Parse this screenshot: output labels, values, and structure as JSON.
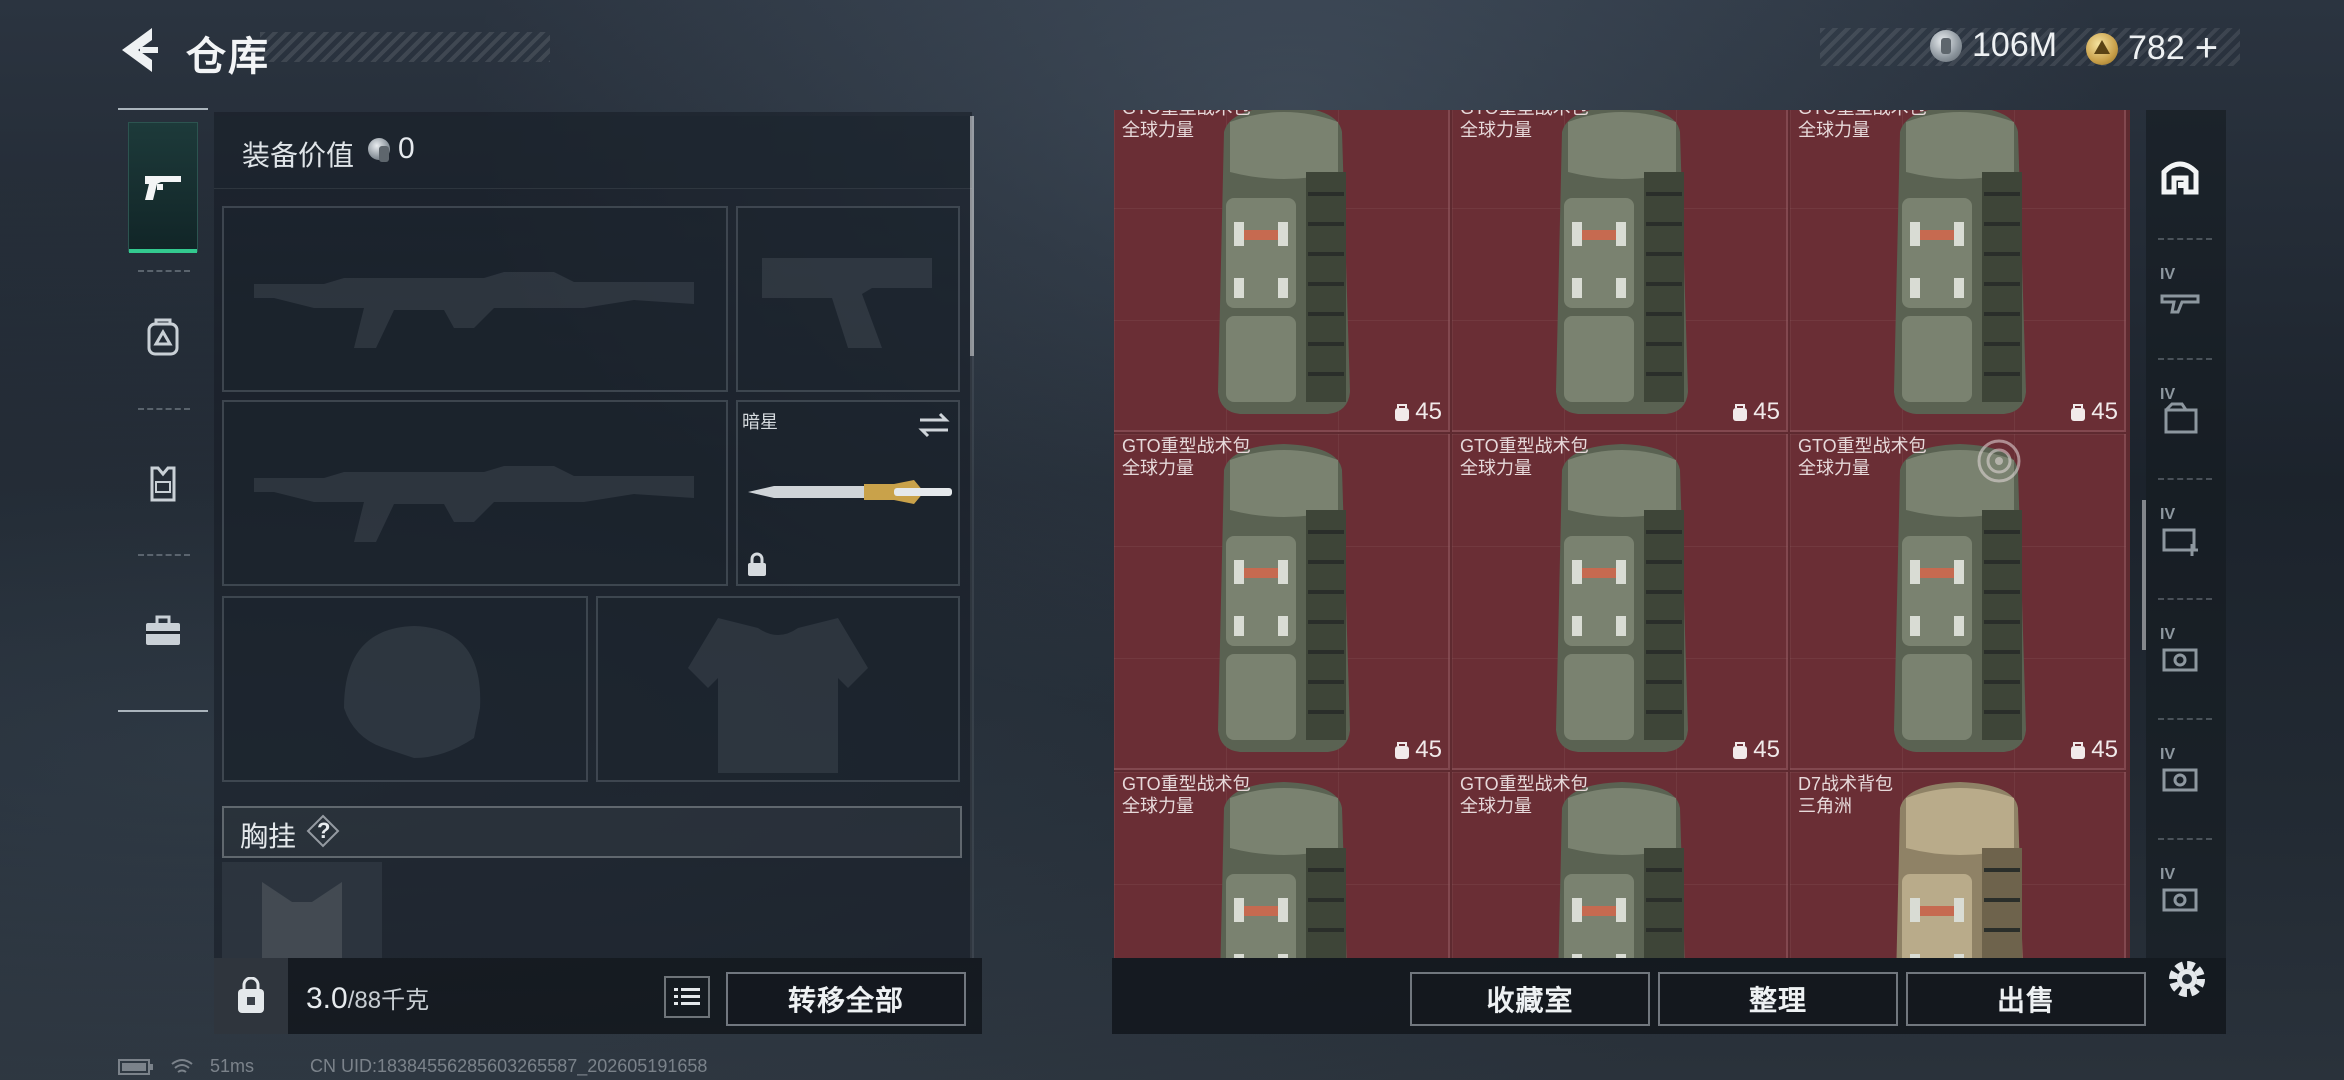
{
  "header": {
    "title": "仓库",
    "currencies": [
      {
        "icon": "silver-coin-icon",
        "amount": "106M"
      },
      {
        "icon": "gold-coin-icon",
        "amount": "782"
      }
    ],
    "add_symbol": "+"
  },
  "left_tabs": [
    {
      "icon": "pistol-icon",
      "active": true
    },
    {
      "icon": "backpack-icon",
      "active": false
    },
    {
      "icon": "chest-rig-icon",
      "active": false
    },
    {
      "icon": "toolbox-icon",
      "active": false
    }
  ],
  "loadout": {
    "value_label": "装备价值",
    "value": "0",
    "melee_name": "暗星",
    "chest_rig_label": "胸挂",
    "chest_rig_help": "?"
  },
  "footer_left": {
    "weight_current": "3.0",
    "weight_max": "/88千克",
    "transfer_all": "转移全部"
  },
  "stash": {
    "items": [
      {
        "name": "GTO重型战术包",
        "source": "全球力量",
        "capacity": "45",
        "variant": "olive",
        "marked": false
      },
      {
        "name": "GTO重型战术包",
        "source": "全球力量",
        "capacity": "45",
        "variant": "olive",
        "marked": false
      },
      {
        "name": "GTO重型战术包",
        "source": "全球力量",
        "capacity": "45",
        "variant": "olive",
        "marked": false
      },
      {
        "name": "GTO重型战术包",
        "source": "全球力量",
        "capacity": "45",
        "variant": "olive",
        "marked": false
      },
      {
        "name": "GTO重型战术包",
        "source": "全球力量",
        "capacity": "45",
        "variant": "olive",
        "marked": false
      },
      {
        "name": "GTO重型战术包",
        "source": "全球力量",
        "capacity": "45",
        "variant": "olive",
        "marked": true
      },
      {
        "name": "GTO重型战术包",
        "source": "全球力量",
        "capacity": "",
        "variant": "olive",
        "marked": false
      },
      {
        "name": "GTO重型战术包",
        "source": "全球力量",
        "capacity": "",
        "variant": "olive",
        "marked": false
      },
      {
        "name": "D7战术背包",
        "source": "三角洲",
        "capacity": "",
        "variant": "tan",
        "marked": false
      }
    ],
    "accent_bg": "#6a2e35"
  },
  "footer_right": {
    "collection": "收藏室",
    "sort": "整理",
    "sell": "出售"
  },
  "filter_tabs": [
    {
      "icon": "all-items-icon",
      "tier": ""
    },
    {
      "icon": "weapon-tier-icon",
      "tier": "IV"
    },
    {
      "icon": "document-tier-icon",
      "tier": "IV"
    },
    {
      "icon": "medical-tier-icon",
      "tier": "IV"
    },
    {
      "icon": "cash-tier-icon",
      "tier": "IV"
    },
    {
      "icon": "cash-tier-icon",
      "tier": "IV"
    },
    {
      "icon": "cash-tier-icon",
      "tier": "IV"
    }
  ],
  "status_bar": {
    "ping": "51ms",
    "uid": "CN UID:18384556285603265587_202605191658"
  }
}
